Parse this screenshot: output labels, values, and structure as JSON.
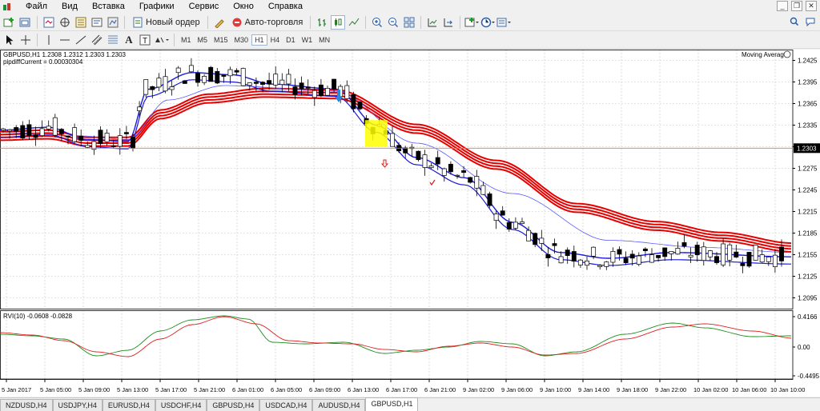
{
  "menu": [
    "Файл",
    "Вид",
    "Вставка",
    "Графики",
    "Сервис",
    "Окно",
    "Справка"
  ],
  "toolbar": {
    "new_order": "Новый ордер",
    "autotrade": "Авто-торговля",
    "timeframes": [
      "M1",
      "M5",
      "M15",
      "M30",
      "H1",
      "H4",
      "D1",
      "W1",
      "MN"
    ],
    "active_timeframe": "H1"
  },
  "chart": {
    "symbol_info": "GBPUSD,H1  1.2308 1.2312 1.2303 1.2303",
    "indicator_label": "pipdiffCurrent = 0.00030304",
    "ea_label": "Moving Average",
    "price_levels": [
      "1.2425",
      "1.2395",
      "1.2365",
      "1.2335",
      "1.2305",
      "1.2275",
      "1.2245",
      "1.2215",
      "1.2185",
      "1.2155",
      "1.2125",
      "1.2095"
    ],
    "current_price": "1.2303",
    "rvi_label": "RVI(10) -0.0608 -0.0828",
    "rvi_levels": [
      "0.4166",
      "0.00",
      "-0.4495"
    ],
    "time_labels": [
      "5 Jan 2017",
      "5 Jan 05:00",
      "5 Jan 09:00",
      "5 Jan 13:00",
      "5 Jan 17:00",
      "5 Jan 21:00",
      "6 Jan 01:00",
      "6 Jan 05:00",
      "6 Jan 09:00",
      "6 Jan 13:00",
      "6 Jan 17:00",
      "6 Jan 21:00",
      "9 Jan 02:00",
      "9 Jan 06:00",
      "9 Jan 10:00",
      "9 Jan 14:00",
      "9 Jan 18:00",
      "9 Jan 22:00",
      "10 Jan 02:00",
      "10 Jan 06:00",
      "10 Jan 10:00"
    ]
  },
  "tabs": [
    "NZDUSD,H4",
    "USDJPY,H4",
    "EURUSD,H4",
    "USDCHF,H4",
    "GBPUSD,H4",
    "USDCAD,H4",
    "AUDUSD,H4",
    "GBPUSD,H1"
  ],
  "active_tab": "GBPUSD,H1",
  "colors": {
    "bull_candle": "#ffffff",
    "bear_candle": "#000000",
    "ma_red": "#e60000",
    "ma_blue": "#1a1adc",
    "ma_lightblue": "#5a5aff",
    "price_line": "#e07a3c",
    "rvi_green": "#1e8c1e",
    "rvi_red": "#e01e1e",
    "highlight": "#ffff00"
  }
}
